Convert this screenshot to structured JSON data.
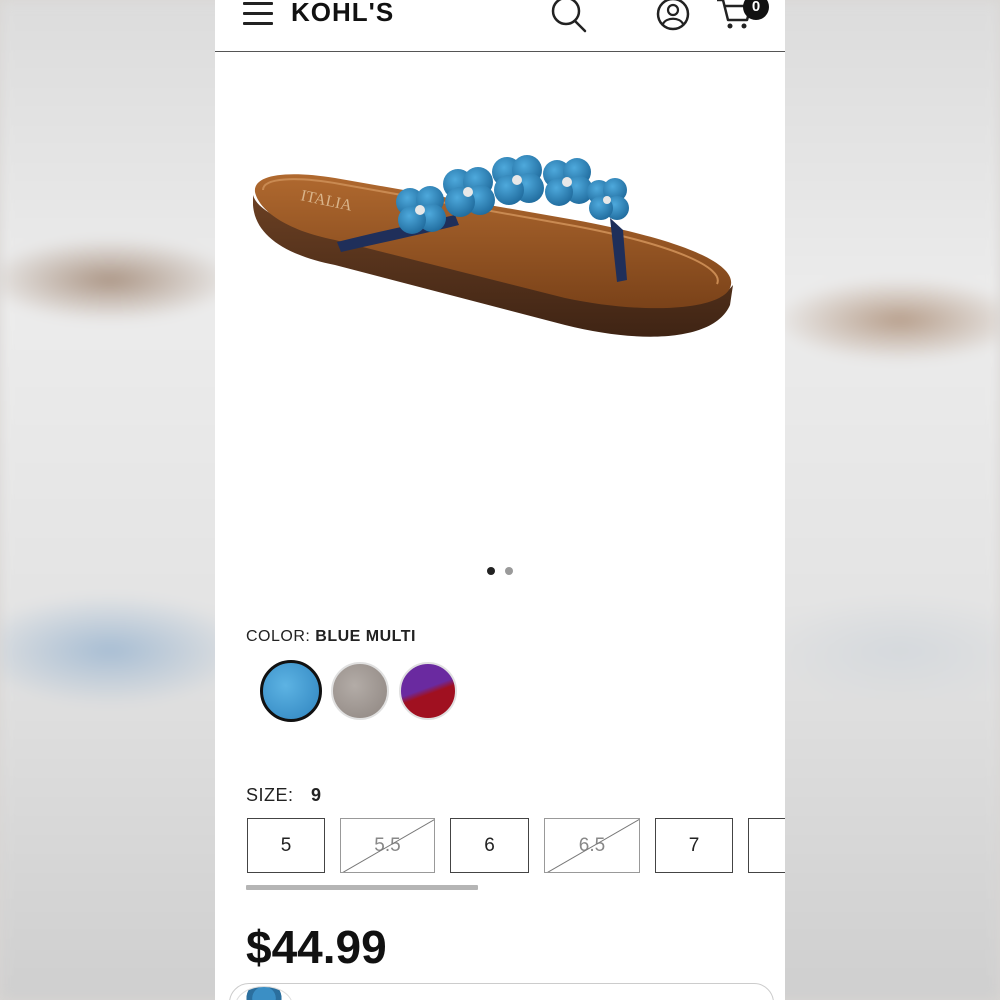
{
  "header": {
    "brand": "KOHL'S",
    "cart_count": "0",
    "icons": [
      "menu-icon",
      "search-icon",
      "account-icon",
      "cart-icon"
    ]
  },
  "product": {
    "image_brand_text": "ITALIA",
    "carousel": {
      "total": 2,
      "active": 1
    },
    "color": {
      "label": "COLOR:",
      "value": "BLUE MULTI",
      "swatches": [
        {
          "name": "Blue Multi",
          "hex": "#3a8fc8",
          "selected": true
        },
        {
          "name": "Taupe",
          "hex": "#9d9590",
          "selected": false
        },
        {
          "name": "Purple/Red",
          "hex": "#8a1a2e",
          "selected": false
        }
      ]
    },
    "size": {
      "label": "SIZE:",
      "value": "9",
      "options": [
        {
          "label": "5",
          "available": true
        },
        {
          "label": "5.5",
          "available": false
        },
        {
          "label": "6",
          "available": true
        },
        {
          "label": "6.5",
          "available": false
        },
        {
          "label": "7",
          "available": true
        }
      ]
    },
    "price": "$44.99"
  },
  "colors": {
    "text": "#111111",
    "header_border": "#555555",
    "sole_brown": "#9b5a2a",
    "strap_blue": "#2f7fb8"
  }
}
